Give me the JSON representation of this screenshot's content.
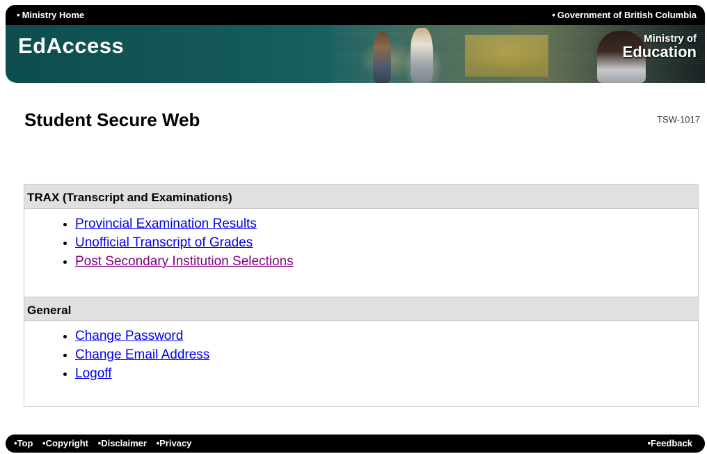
{
  "header": {
    "top_left_link": "Ministry Home",
    "top_right_link": "Government of British Columbia",
    "brand": "EdAccess",
    "ministry_logo_line1": "Ministry of",
    "ministry_logo_line2": "Education"
  },
  "page": {
    "title": "Student Secure Web",
    "screen_id": "TSW-1017"
  },
  "sections": [
    {
      "title": "TRAX (Transcript and Examinations)",
      "links": [
        "Provincial Examination Results",
        "Unofficial Transcript of Grades",
        "Post Secondary Institution Selections"
      ]
    },
    {
      "title": "General",
      "links": [
        "Change Password",
        "Change Email Address",
        "Logoff"
      ]
    }
  ],
  "footer": {
    "links": [
      "Top",
      "Copyright",
      "Disclaimer",
      "Privacy"
    ],
    "right_link": "Feedback"
  },
  "colors": {
    "link": "#0000ee",
    "visited_link": "#800080",
    "section_header_bg": "#e0e0e0",
    "banner_teal": "#0d4d4e",
    "bar_black": "#000000"
  }
}
